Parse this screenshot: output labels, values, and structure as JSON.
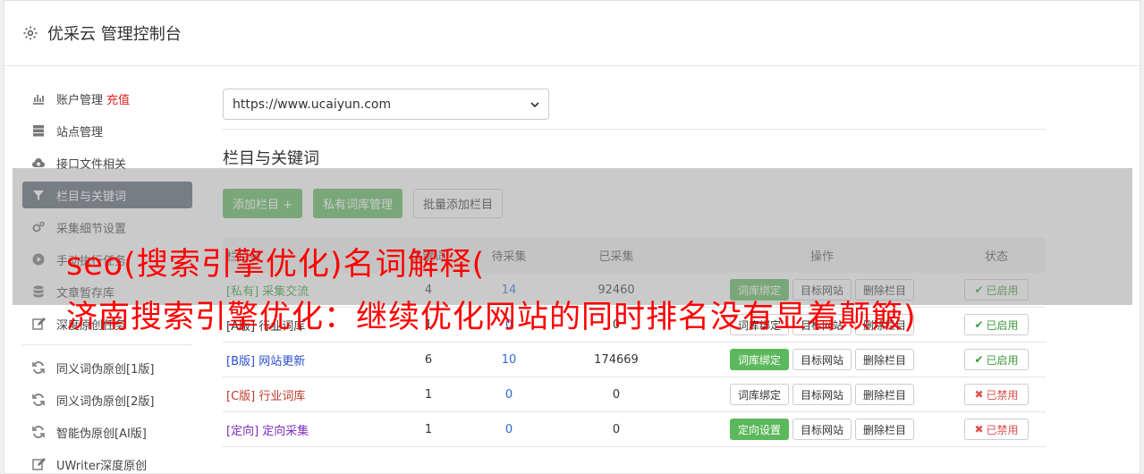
{
  "header": {
    "title": "优采云 管理控制台"
  },
  "sidebar": {
    "items": [
      {
        "label": "账户管理",
        "extra": "充值",
        "icon": "bar-chart-icon"
      },
      {
        "label": "站点管理",
        "icon": "server-icon"
      },
      {
        "label": "接口文件相关",
        "icon": "cloud-upload-icon"
      },
      {
        "label": "栏目与关键词",
        "icon": "filter-icon",
        "active": true
      },
      {
        "label": "采集细节设置",
        "icon": "gears-icon"
      },
      {
        "label": "手动执行任务",
        "icon": "play-circle-icon"
      },
      {
        "label": "文章暂存库",
        "icon": "database-icon"
      },
      {
        "label": "深度原创任务",
        "icon": "edit-icon"
      }
    ],
    "items2": [
      {
        "label": "同义词伪原创[1版]",
        "icon": "refresh-icon"
      },
      {
        "label": "同义词伪原创[2版]",
        "icon": "refresh-icon"
      },
      {
        "label": "智能伪原创[AI版]",
        "icon": "refresh-icon"
      },
      {
        "label": "UWriter深度原创",
        "icon": "edit-icon"
      }
    ]
  },
  "main": {
    "site_select": "https://www.ucaiyun.com",
    "section_title": "栏目与关键词",
    "buttons": {
      "add_column": "添加栏目 +",
      "private_lib": "私有词库管理",
      "batch_add": "批量添加栏目"
    },
    "table": {
      "headers": [
        "栏目名",
        "关键词",
        "待采集",
        "已采集",
        "操作",
        "状态"
      ],
      "rows": [
        {
          "tag": "[私有]",
          "name": "采集交流",
          "a": "4",
          "b": "14",
          "c": "92460",
          "act1": "词库绑定",
          "act1_green": true,
          "act2": "目标网站",
          "act3": "删除栏目",
          "status": "已启用",
          "on": true,
          "color": "#3c9a3c"
        },
        {
          "tag": "[A版]",
          "name": "行业词库",
          "a": "1",
          "b": "0",
          "c": "0",
          "act1": "词库绑定",
          "act1_green": false,
          "act2": "目标网站",
          "act3": "删除栏目",
          "status": "已启用",
          "on": true,
          "color": "#333333"
        },
        {
          "tag": "[B版]",
          "name": "网站更新",
          "a": "6",
          "b": "10",
          "c": "174669",
          "act1": "词库绑定",
          "act1_green": true,
          "act2": "目标网站",
          "act3": "删除栏目",
          "status": "已启用",
          "on": true,
          "color": "#2a4fd1"
        },
        {
          "tag": "[C版]",
          "name": "行业词库",
          "a": "1",
          "b": "0",
          "c": "0",
          "act1": "词库绑定",
          "act1_green": false,
          "act2": "目标网站",
          "act3": "删除栏目",
          "status": "已禁用",
          "on": false,
          "color": "#c0392b"
        },
        {
          "tag": "[定向]",
          "name": "定向采集",
          "a": "1",
          "b": "0",
          "c": "0",
          "act1": "定向设置",
          "act1_green": true,
          "act2": "目标网站",
          "act3": "删除栏目",
          "status": "已禁用",
          "on": false,
          "color": "#7b2fbf"
        }
      ]
    }
  },
  "overlay": {
    "line1": "seo(搜索引擎优化)名词解释(",
    "line2": "济南搜索引擎优化：继续优化网站的同时排名没有显着颠簸)"
  }
}
